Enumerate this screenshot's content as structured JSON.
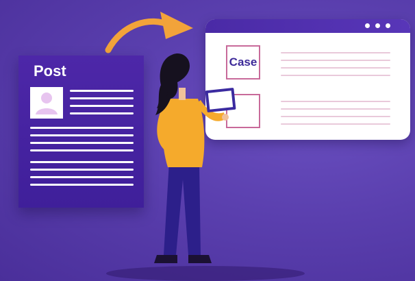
{
  "post_card": {
    "title": "Post",
    "icon": "user-avatar-icon"
  },
  "browser": {
    "case_label": "Case",
    "icons": [
      "dot-icon",
      "dot-icon",
      "dot-icon"
    ]
  },
  "arrow": {
    "icon": "curved-arrow-icon"
  },
  "colors": {
    "background": "#5a3fae",
    "card": "#4d27a8",
    "accent_orange": "#f2a33a",
    "box_border": "#c86a9a",
    "text_dark": "#3d2a99"
  }
}
